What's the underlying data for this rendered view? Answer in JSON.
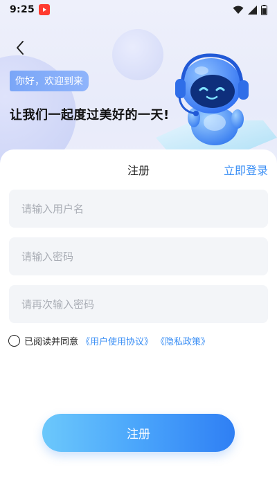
{
  "status_bar": {
    "time": "9:25"
  },
  "header": {
    "greeting": "你好，欢迎到来",
    "headline": "让我们一起度过美好的一天!"
  },
  "form": {
    "title": "注册",
    "login_link": "立即登录",
    "username_placeholder": "请输入用户名",
    "password_placeholder": "请输入密码",
    "confirm_password_placeholder": "请再次输入密码",
    "agree_text": "已阅读并同意",
    "user_agreement": "《用户使用协议》",
    "privacy_policy": "《隐私政策》",
    "submit_label": "注册"
  },
  "colors": {
    "accent": "#3b8ff5",
    "button_start": "#6cc8fb",
    "button_end": "#2f7ff4",
    "field_bg": "#f3f5f8"
  },
  "icons": [
    "back-arrow-icon",
    "wifi-icon",
    "signal-icon",
    "battery-icon",
    "robot-mascot-illustration"
  ]
}
